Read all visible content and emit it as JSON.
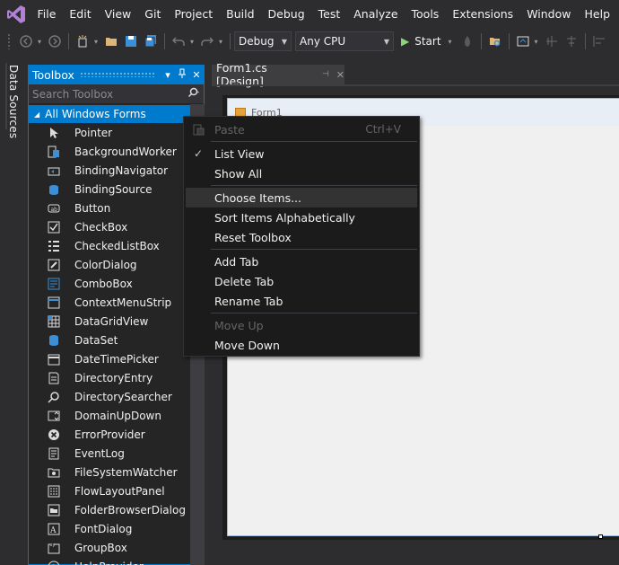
{
  "menubar": {
    "items": [
      "File",
      "Edit",
      "View",
      "Git",
      "Project",
      "Build",
      "Debug",
      "Test",
      "Analyze",
      "Tools",
      "Extensions",
      "Window",
      "Help"
    ]
  },
  "toolbar": {
    "config_value": "Debug",
    "platform_value": "Any CPU",
    "start_label": "Start"
  },
  "side_tab": {
    "label": "Data Sources"
  },
  "toolbox": {
    "title": "Toolbox",
    "search_placeholder": "Search Toolbox",
    "group_label": "All Windows Forms",
    "items": [
      {
        "label": "Pointer",
        "icon": "pointer-icon"
      },
      {
        "label": "BackgroundWorker",
        "icon": "backgroundworker-icon"
      },
      {
        "label": "BindingNavigator",
        "icon": "bindingnavigator-icon"
      },
      {
        "label": "BindingSource",
        "icon": "bindingsource-icon"
      },
      {
        "label": "Button",
        "icon": "button-icon"
      },
      {
        "label": "CheckBox",
        "icon": "checkbox-icon"
      },
      {
        "label": "CheckedListBox",
        "icon": "checkedlistbox-icon"
      },
      {
        "label": "ColorDialog",
        "icon": "colordialog-icon"
      },
      {
        "label": "ComboBox",
        "icon": "combobox-icon"
      },
      {
        "label": "ContextMenuStrip",
        "icon": "contextmenustrip-icon"
      },
      {
        "label": "DataGridView",
        "icon": "datagridview-icon"
      },
      {
        "label": "DataSet",
        "icon": "dataset-icon"
      },
      {
        "label": "DateTimePicker",
        "icon": "datetimepicker-icon"
      },
      {
        "label": "DirectoryEntry",
        "icon": "directoryentry-icon"
      },
      {
        "label": "DirectorySearcher",
        "icon": "directorysearcher-icon"
      },
      {
        "label": "DomainUpDown",
        "icon": "domainupdown-icon"
      },
      {
        "label": "ErrorProvider",
        "icon": "errorprovider-icon"
      },
      {
        "label": "EventLog",
        "icon": "eventlog-icon"
      },
      {
        "label": "FileSystemWatcher",
        "icon": "filesystemwatcher-icon"
      },
      {
        "label": "FlowLayoutPanel",
        "icon": "flowlayoutpanel-icon"
      },
      {
        "label": "FolderBrowserDialog",
        "icon": "folderbrowserdialog-icon"
      },
      {
        "label": "FontDialog",
        "icon": "fontdialog-icon"
      },
      {
        "label": "GroupBox",
        "icon": "groupbox-icon"
      },
      {
        "label": "HelpProvider",
        "icon": "helpprovider-icon"
      }
    ]
  },
  "document": {
    "tab_label": "Form1.cs [Design]",
    "form_title": "Form1"
  },
  "context_menu": {
    "paste": {
      "label": "Paste",
      "shortcut": "Ctrl+V"
    },
    "list_view": "List View",
    "show_all": "Show All",
    "choose_items": "Choose Items...",
    "sort_alpha": "Sort Items Alphabetically",
    "reset_toolbox": "Reset Toolbox",
    "add_tab": "Add Tab",
    "delete_tab": "Delete Tab",
    "rename_tab": "Rename Tab",
    "move_up": "Move Up",
    "move_down": "Move Down"
  },
  "colors": {
    "accent": "#007acc",
    "background": "#2d2d30",
    "menu_bg": "#1b1b1c"
  }
}
